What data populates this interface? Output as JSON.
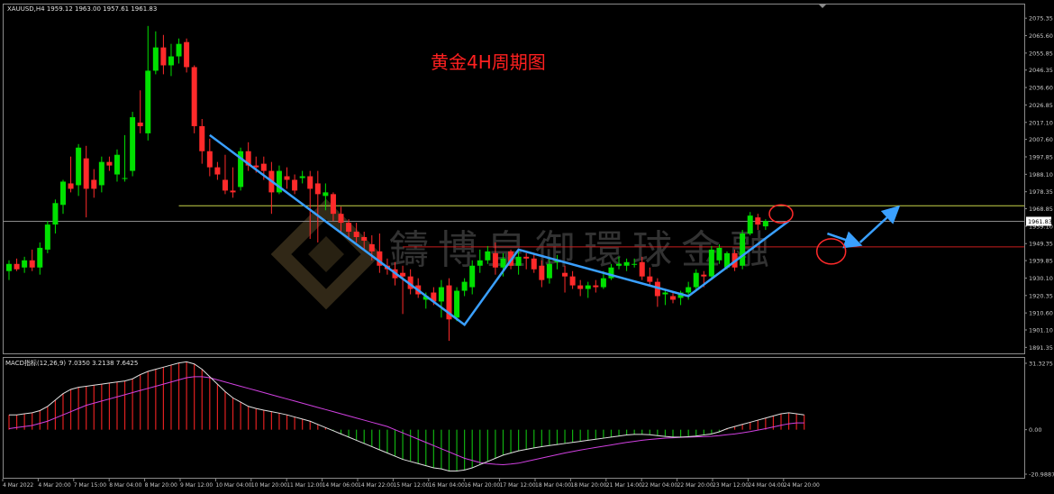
{
  "symbol_info": "XAUUSD,H4  1959.12 1963.00 1957.61 1961.83",
  "macd_info": "MACD指标(12,26,9)  7.0350 3.2138 7.6425",
  "annotation_title": "黄金4H周期图",
  "watermark": "鑄博皇御環球金融",
  "colors": {
    "bull": "#00e000",
    "bear": "#ff2a2a",
    "yellow_line": "#c8d44a",
    "red_line": "#c81e1e",
    "trend": "#3aa0ff",
    "macd_line": "#e0e0e0",
    "signal_line": "#d040e0",
    "hist_pos": "#e02020",
    "hist_neg": "#10b010",
    "axis_text": "#c8c8c8",
    "title": "#ff2020"
  },
  "chart_data": [
    {
      "type": "candlestick",
      "name": "XAUUSD H4",
      "ylim": [
        1888,
        2083
      ],
      "y_ticks": [
        "2075.35",
        "2065.60",
        "2055.85",
        "2046.35",
        "2036.60",
        "2026.85",
        "2017.10",
        "2007.60",
        "1997.85",
        "1988.10",
        "1978.35",
        "1968.85",
        "1959.10",
        "1949.35",
        "1939.85",
        "1930.10",
        "1920.35",
        "1910.60",
        "1901.10",
        "1891.35"
      ],
      "x_labels": [
        "4 Mar 2022",
        "4 Mar 20:00",
        "7 Mar 15:00",
        "8 Mar 04:00",
        "8 Mar 20:00",
        "9 Mar 12:00",
        "10 Mar 04:00",
        "10 Mar 20:00",
        "11 Mar 12:00",
        "14 Mar 06:00",
        "14 Mar 22:00",
        "15 Mar 12:00",
        "16 Mar 04:00",
        "16 Mar 20:00",
        "17 Mar 12:00",
        "18 Mar 04:00",
        "18 Mar 20:00",
        "21 Mar 14:00",
        "22 Mar 04:00",
        "22 Mar 20:00",
        "23 Mar 12:00",
        "24 Mar 04:00",
        "24 Mar 20:00"
      ],
      "current_price": "1961.83",
      "levels": [
        {
          "name": "resistance",
          "price": 1970.5,
          "from_index": 22,
          "color": "yellow"
        },
        {
          "name": "bid",
          "price": 1961.83,
          "from_index": 0,
          "color": "grey"
        },
        {
          "name": "support",
          "price": 1947.5,
          "from_index": 51,
          "color": "red"
        }
      ],
      "ohlc": [
        [
          1934,
          1940,
          1929,
          1938
        ],
        [
          1938,
          1941,
          1934,
          1935
        ],
        [
          1936,
          1942,
          1933,
          1940
        ],
        [
          1940,
          1946,
          1934,
          1936
        ],
        [
          1936,
          1950,
          1932,
          1947
        ],
        [
          1946,
          1962,
          1944,
          1960
        ],
        [
          1960,
          1974,
          1955,
          1972
        ],
        [
          1971,
          1985,
          1966,
          1984
        ],
        [
          1983,
          1998,
          1978,
          1980
        ],
        [
          1982,
          2005,
          1976,
          2003
        ],
        [
          1997,
          2004,
          1964,
          1980
        ],
        [
          1985,
          1991,
          1975,
          1980
        ],
        [
          1982,
          1998,
          1978,
          1995
        ],
        [
          1995,
          1998,
          1990,
          1993
        ],
        [
          1988,
          2002,
          1984,
          1999
        ],
        [
          1986,
          2010,
          1984,
          1986
        ],
        [
          1990,
          2023,
          1987,
          2020
        ],
        [
          2017,
          2035,
          2011,
          2015
        ],
        [
          2011,
          2071,
          2007,
          2046
        ],
        [
          2046,
          2068,
          2044,
          2059
        ],
        [
          2059,
          2066,
          2044,
          2049
        ],
        [
          2049,
          2061,
          2043,
          2054
        ],
        [
          2054,
          2064,
          2050,
          2061
        ],
        [
          2062,
          2064,
          2045,
          2048
        ],
        [
          2048,
          2049,
          2011,
          2015
        ],
        [
          2015,
          2019,
          1994,
          2001
        ],
        [
          2001,
          2008,
          1987,
          1992
        ],
        [
          1992,
          1995,
          1985,
          1988
        ],
        [
          1985,
          1999,
          1977,
          1979
        ],
        [
          1979,
          1992,
          1975,
          1978
        ],
        [
          1981,
          2003,
          1979,
          2001
        ],
        [
          2001,
          2006,
          1990,
          1993
        ],
        [
          1993,
          1998,
          1989,
          1992
        ],
        [
          1994,
          1998,
          1985,
          1990
        ],
        [
          1990,
          1995,
          1966,
          1978
        ],
        [
          1978,
          1993,
          1977,
          1990
        ],
        [
          1987,
          1992,
          1980,
          1985
        ],
        [
          1985,
          1988,
          1977,
          1979
        ],
        [
          1986,
          1990,
          1983,
          1987
        ],
        [
          1987,
          1990,
          1952,
          1980
        ],
        [
          1983,
          1990,
          1950,
          1977
        ],
        [
          1976,
          1983,
          1968,
          1978
        ],
        [
          1977,
          1978,
          1962,
          1966
        ],
        [
          1966,
          1970,
          1956,
          1961
        ],
        [
          1961,
          1963,
          1953,
          1956
        ],
        [
          1956,
          1961,
          1950,
          1953
        ],
        [
          1953,
          1956,
          1946,
          1951
        ],
        [
          1949,
          1954,
          1940,
          1945
        ],
        [
          1945,
          1955,
          1933,
          1937
        ],
        [
          1937,
          1941,
          1932,
          1935
        ],
        [
          1935,
          1939,
          1926,
          1930
        ],
        [
          1933,
          1937,
          1910,
          1931
        ],
        [
          1931,
          1935,
          1921,
          1924
        ],
        [
          1926,
          1930,
          1919,
          1921
        ],
        [
          1918,
          1922,
          1913,
          1920
        ],
        [
          1922,
          1925,
          1915,
          1917
        ],
        [
          1917,
          1929,
          1908,
          1925
        ],
        [
          1926,
          1930,
          1895,
          1907
        ],
        [
          1908,
          1925,
          1906,
          1923
        ],
        [
          1923,
          1930,
          1920,
          1928
        ],
        [
          1925,
          1940,
          1921,
          1937
        ],
        [
          1937,
          1946,
          1933,
          1940
        ],
        [
          1940,
          1948,
          1938,
          1945
        ],
        [
          1944,
          1950,
          1932,
          1936
        ],
        [
          1936,
          1944,
          1931,
          1941
        ],
        [
          1945,
          1946,
          1935,
          1937
        ],
        [
          1937,
          1945,
          1932,
          1942
        ],
        [
          1942,
          1944,
          1935,
          1941
        ],
        [
          1941,
          1944,
          1933,
          1935
        ],
        [
          1937,
          1940,
          1925,
          1929
        ],
        [
          1930,
          1941,
          1927,
          1938
        ],
        [
          1939,
          1943,
          1935,
          1940
        ],
        [
          1933,
          1937,
          1922,
          1931
        ],
        [
          1931,
          1934,
          1924,
          1926
        ],
        [
          1926,
          1929,
          1920,
          1924
        ],
        [
          1924,
          1928,
          1919,
          1926
        ],
        [
          1926,
          1929,
          1922,
          1925
        ],
        [
          1925,
          1934,
          1924,
          1930
        ],
        [
          1930,
          1938,
          1929,
          1936
        ],
        [
          1937,
          1942,
          1935,
          1938
        ],
        [
          1937,
          1941,
          1934,
          1939
        ],
        [
          1938,
          1941,
          1936,
          1938
        ],
        [
          1939,
          1942,
          1929,
          1931
        ],
        [
          1931,
          1936,
          1926,
          1928
        ],
        [
          1928,
          1930,
          1914,
          1920
        ],
        [
          1921,
          1924,
          1915,
          1922
        ],
        [
          1920,
          1922,
          1916,
          1918
        ],
        [
          1919,
          1923,
          1915,
          1922
        ],
        [
          1922,
          1928,
          1918,
          1925
        ],
        [
          1925,
          1935,
          1923,
          1933
        ],
        [
          1932,
          1934,
          1925,
          1931
        ],
        [
          1931,
          1948,
          1929,
          1946
        ],
        [
          1940,
          1949,
          1938,
          1947
        ],
        [
          1936,
          1945,
          1935,
          1944
        ],
        [
          1944,
          1946,
          1934,
          1936
        ],
        [
          1937,
          1957,
          1935,
          1955
        ],
        [
          1955,
          1967,
          1954,
          1965
        ],
        [
          1964,
          1966,
          1957,
          1960
        ],
        [
          1959,
          1963,
          1957,
          1962
        ]
      ]
    },
    {
      "type": "macd",
      "name": "MACD(12,26,9)",
      "ylim": [
        -20.9887,
        31.3275
      ],
      "y_ticks": [
        "31.3275",
        "0.00",
        "-20.9887"
      ],
      "macd": [
        7,
        7,
        7.5,
        8,
        9,
        11,
        14,
        17,
        19,
        20,
        20.5,
        21,
        21.5,
        22,
        22.5,
        23,
        24,
        26,
        27.5,
        28.5,
        29.5,
        30.5,
        31.5,
        32,
        31,
        28.5,
        25,
        21.5,
        18,
        15,
        13,
        11,
        10,
        9.2,
        8.5,
        7.8,
        7,
        6,
        5,
        4,
        2.5,
        1,
        -0.5,
        -2,
        -3.5,
        -5,
        -6.5,
        -8,
        -9.5,
        -11,
        -12.5,
        -14,
        -15,
        -16,
        -17,
        -18,
        -18.5,
        -19.5,
        -19.5,
        -19,
        -18,
        -16.5,
        -15,
        -13.5,
        -12,
        -11,
        -10,
        -9.3,
        -8.6,
        -8,
        -7.5,
        -7,
        -6.5,
        -6,
        -5.5,
        -5,
        -4.5,
        -4,
        -3.5,
        -3,
        -2.5,
        -2.2,
        -2.2,
        -2.4,
        -2.8,
        -3.2,
        -3.5,
        -3.5,
        -3.3,
        -3,
        -2.5,
        -2,
        -1,
        0.5,
        1.5,
        2.5,
        3.5,
        4.5,
        5.5,
        6.5,
        7.5,
        8,
        7.5,
        7
      ],
      "signal": [
        0.5,
        1,
        1.5,
        2,
        3,
        4,
        5.5,
        7,
        8.5,
        10,
        11.5,
        12.5,
        13.5,
        14.5,
        15.5,
        16.5,
        17.5,
        18.5,
        19.5,
        20.5,
        21.5,
        22.5,
        23.5,
        24.5,
        25,
        25,
        24.5,
        23.5,
        22.5,
        21.5,
        20.5,
        19.5,
        18.5,
        17.5,
        16.5,
        15.5,
        14.5,
        13.5,
        12.5,
        11.5,
        10.5,
        9.5,
        8.5,
        7.5,
        6.5,
        5.5,
        4.5,
        3.5,
        2.5,
        1.5,
        0,
        -1.5,
        -3,
        -4.5,
        -6,
        -7.5,
        -9,
        -10.5,
        -12,
        -13.5,
        -14.5,
        -15.5,
        -16,
        -16.3,
        -16.5,
        -16.2,
        -15.8,
        -15,
        -14.2,
        -13.4,
        -12.6,
        -11.8,
        -11,
        -10.3,
        -9.6,
        -9,
        -8.4,
        -7.8,
        -7.2,
        -6.6,
        -6,
        -5.5,
        -5,
        -4.6,
        -4.3,
        -4,
        -3.8,
        -3.6,
        -3.5,
        -3.4,
        -3.3,
        -3.1,
        -2.8,
        -2.4,
        -2,
        -1.5,
        -0.9,
        -0.2,
        0.5,
        1.3,
        2.1,
        2.8,
        3.2,
        3.2
      ]
    }
  ]
}
